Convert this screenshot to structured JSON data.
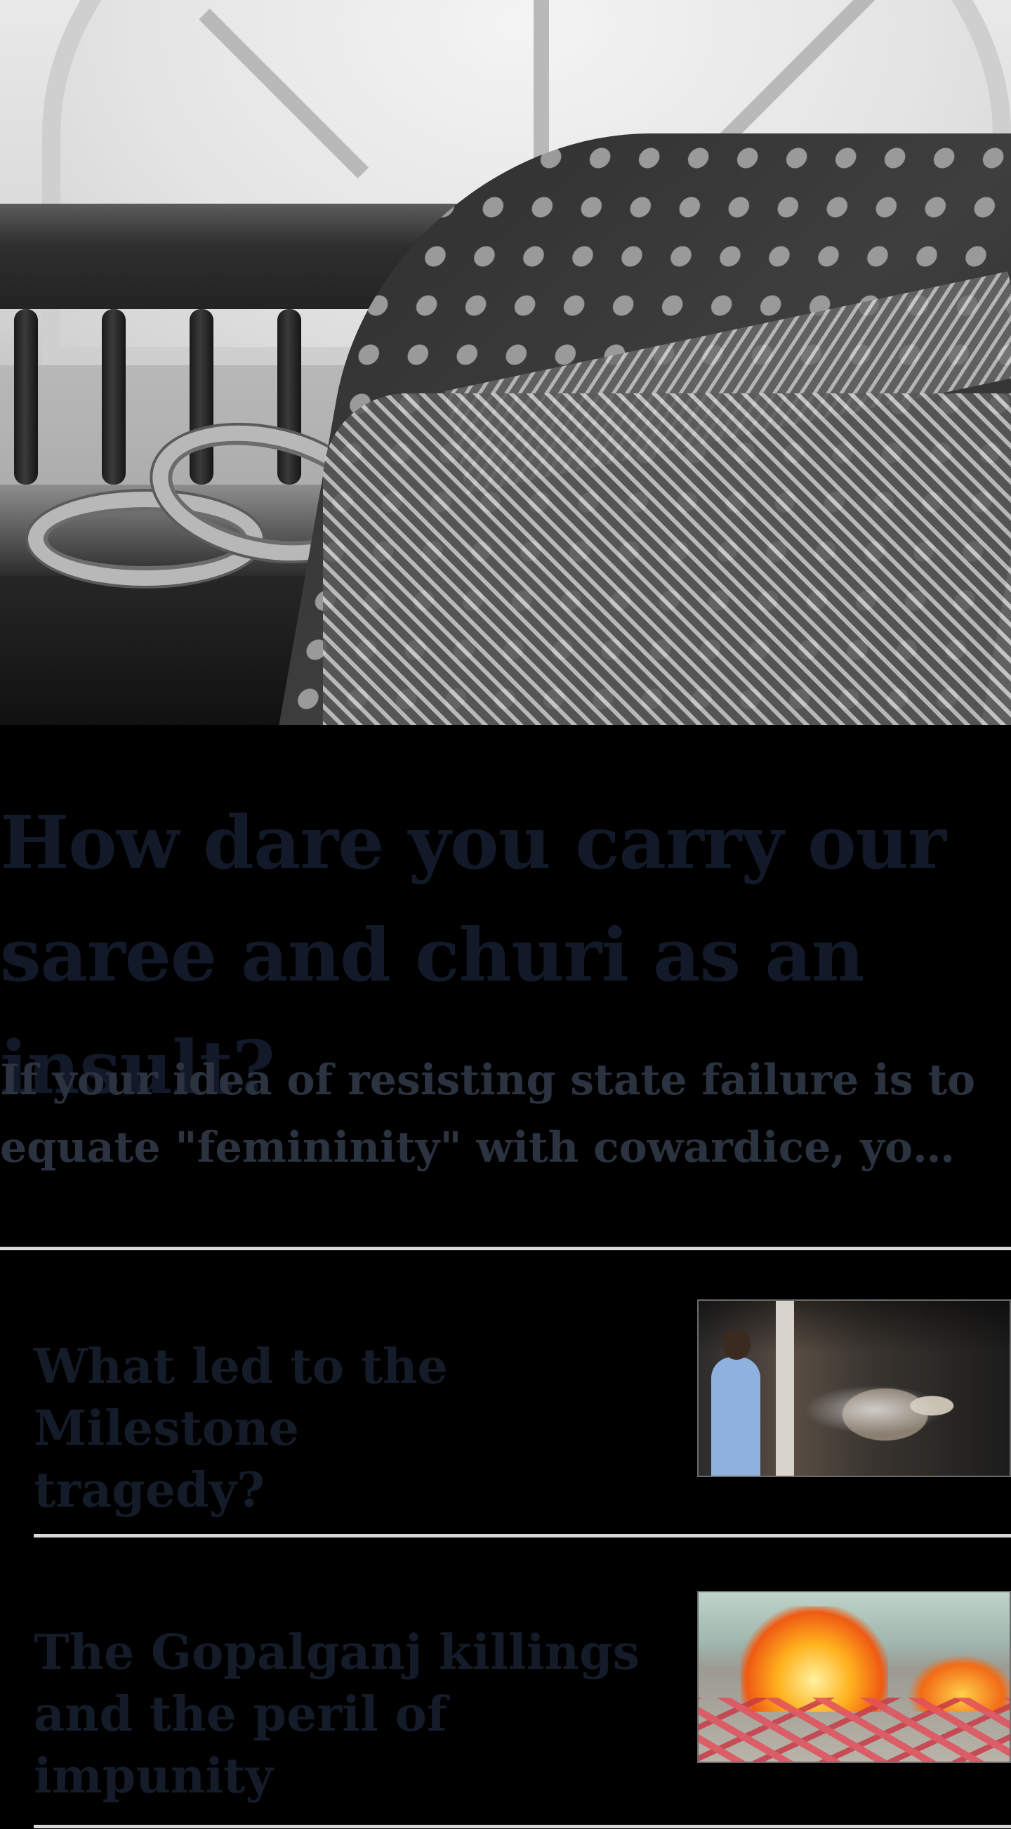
{
  "article": {
    "headline_line1": "How dare you carry our",
    "headline_line2": "saree and churi as an insult?",
    "subhead": "If your idea of resisting state failure is to equate \"femininity\" with cowardice, you a..."
  },
  "related": [
    {
      "title_line1": "What led to the Milestone",
      "title_line2": "tragedy?"
    },
    {
      "title_line1": "The Gopalganj killings",
      "title_line2": "and the peril of impunity"
    }
  ],
  "colors": {
    "background": "#000000",
    "headline": "#121a29",
    "subhead": "#2c3340",
    "divider": "#d9d9d9"
  }
}
